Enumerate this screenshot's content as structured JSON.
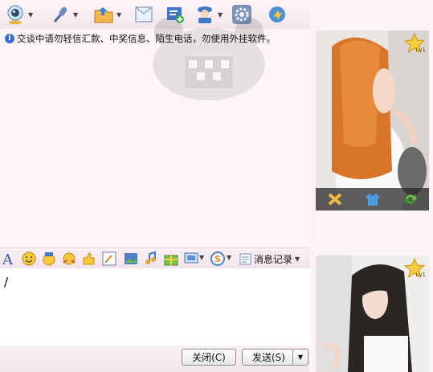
{
  "notice": {
    "icon": "info-icon",
    "text": "交谈中请勿轻信汇款、中奖信息、陌生电话，勿使用外挂软件。"
  },
  "toolbar": {
    "items": [
      {
        "icon": "webcam-icon",
        "has_dropdown": true
      },
      {
        "icon": "microphone-icon",
        "has_dropdown": true
      },
      {
        "icon": "send-file-icon",
        "has_dropdown": true
      },
      {
        "icon": "image-message-icon",
        "has_dropdown": false
      },
      {
        "icon": "add-note-icon",
        "has_dropdown": false
      },
      {
        "icon": "user-card-icon",
        "has_dropdown": true
      },
      {
        "icon": "settings-gear-icon",
        "has_dropdown": false
      },
      {
        "icon": "remote-assist-icon",
        "has_dropdown": false
      }
    ]
  },
  "format_bar": {
    "history_label": "消息记录"
  },
  "input": {
    "value": ""
  },
  "buttons": {
    "close": "关闭(C)",
    "send": "发送(S)"
  },
  "right_panel": {
    "badge_text": "Lv1",
    "badge_text_bottom": "Lv1"
  },
  "colors": {
    "accent_pink": "#f3e4ec",
    "info_blue": "#3b6fcf"
  }
}
